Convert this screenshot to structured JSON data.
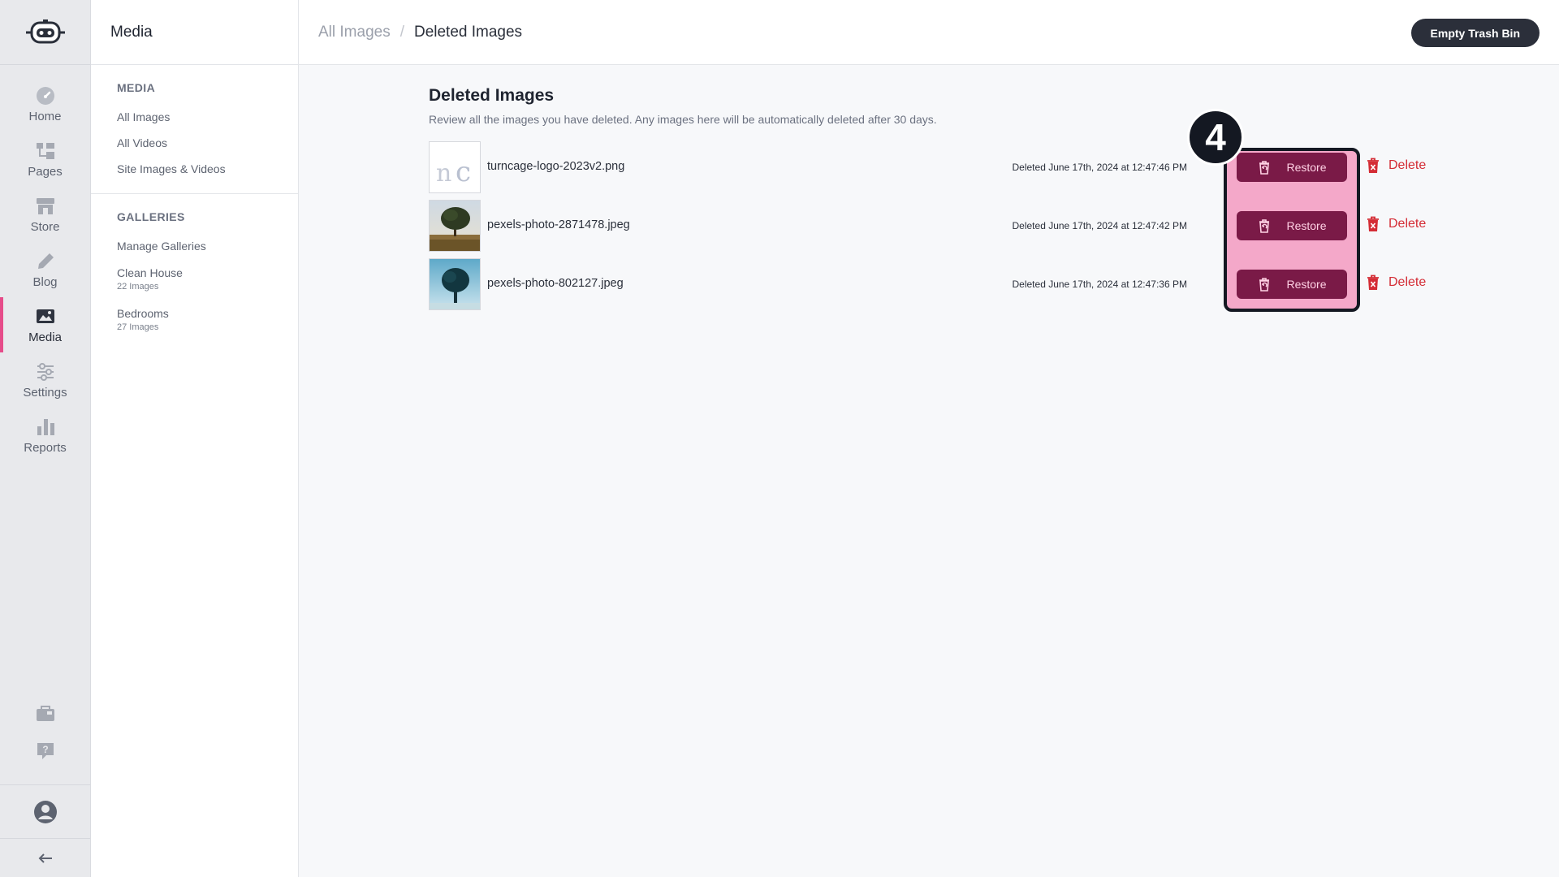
{
  "rail": {
    "items": [
      {
        "label": "Home",
        "icon": "gauge-icon"
      },
      {
        "label": "Pages",
        "icon": "sitemap-icon"
      },
      {
        "label": "Store",
        "icon": "store-icon"
      },
      {
        "label": "Blog",
        "icon": "pencil-icon"
      },
      {
        "label": "Media",
        "icon": "image-stack-icon",
        "active": true
      },
      {
        "label": "Settings",
        "icon": "sliders-icon"
      },
      {
        "label": "Reports",
        "icon": "bar-chart-icon"
      }
    ]
  },
  "subnav": {
    "title": "Media",
    "media_heading": "MEDIA",
    "media_links": [
      "All Images",
      "All Videos",
      "Site Images & Videos"
    ],
    "galleries_heading": "GALLERIES",
    "manage_galleries": "Manage Galleries",
    "galleries": [
      {
        "name": "Clean House",
        "count": "22 Images"
      },
      {
        "name": "Bedrooms",
        "count": "27 Images"
      }
    ]
  },
  "topbar": {
    "breadcrumb_parent": "All Images",
    "breadcrumb_separator": "/",
    "breadcrumb_current": "Deleted Images",
    "empty_trash_label": "Empty Trash Bin"
  },
  "main": {
    "title": "Deleted Images",
    "description": "Review all the images you have deleted. Any images here will be automatically deleted after 30 days.",
    "restore_label": "Restore",
    "delete_label": "Delete",
    "items": [
      {
        "filename": "turncage-logo-2023v2.png",
        "deleted": "Deleted June 17th, 2024 at 12:47:46 PM"
      },
      {
        "filename": "pexels-photo-2871478.jpeg",
        "deleted": "Deleted June 17th, 2024 at 12:47:42 PM"
      },
      {
        "filename": "pexels-photo-802127.jpeg",
        "deleted": "Deleted June 17th, 2024 at 12:47:36 PM"
      }
    ]
  },
  "overlay": {
    "step_number": "4",
    "highlight_color": "#f4a8c9"
  },
  "colors": {
    "accent": "#e64c8a",
    "restore_bg": "#7a1a47",
    "delete": "#d42c35",
    "dark": "#2b2f3a"
  }
}
